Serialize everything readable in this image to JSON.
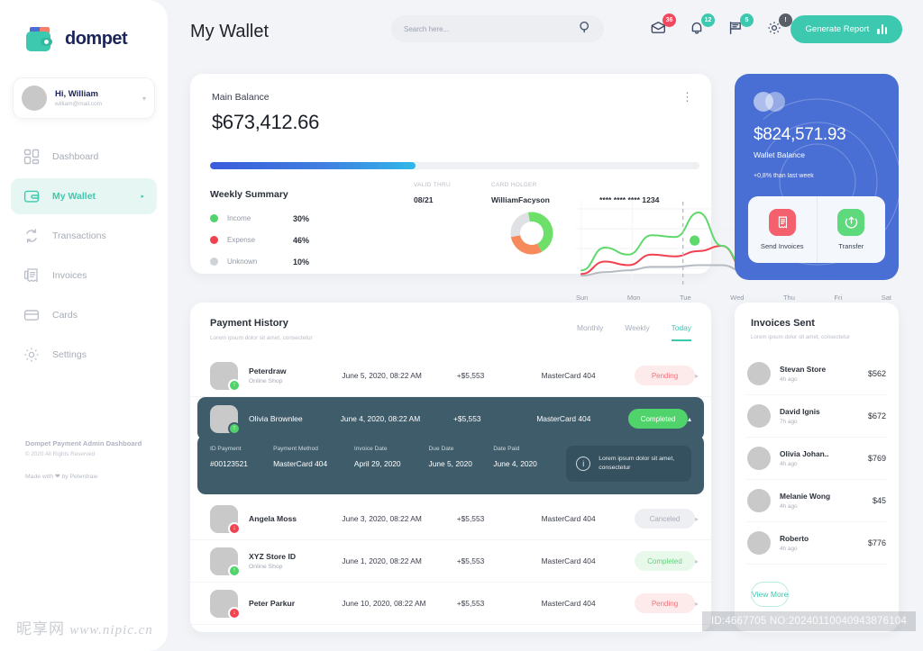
{
  "brand": {
    "name": "dompet",
    "logo_icon": "wallet-logo-icon",
    "accent": "#3dc9b0"
  },
  "sidebar": {
    "profile": {
      "greeting": "Hi, William",
      "email": "william@mail.com",
      "caret": "▾"
    },
    "items": [
      {
        "label": "Dashboard",
        "icon": "grid-icon",
        "active": false
      },
      {
        "label": "My Wallet",
        "icon": "wallet-icon",
        "active": true,
        "arrow": "▸"
      },
      {
        "label": "Transactions",
        "icon": "refresh-icon",
        "active": false
      },
      {
        "label": "Invoices",
        "icon": "receipt-icon",
        "active": false
      },
      {
        "label": "Cards",
        "icon": "card-icon",
        "active": false
      },
      {
        "label": "Settings",
        "icon": "gear-icon",
        "active": false
      }
    ],
    "footer": {
      "line1": "Dompet Payment Admin Dashboard",
      "line2": "© 2020 All Rights Reserved",
      "line3": "Made with ❤ by Peterdraw"
    }
  },
  "header": {
    "title": "My Wallet",
    "search": {
      "placeholder": "Search here...",
      "value": "",
      "icon": "search-icon"
    },
    "icons": [
      {
        "name": "mail-icon",
        "badge": "36",
        "badge_color": "red"
      },
      {
        "name": "bell-icon",
        "badge": "12",
        "badge_color": "teal"
      },
      {
        "name": "message-icon",
        "badge": "5",
        "badge_color": "teal"
      },
      {
        "name": "gear-icon",
        "badge": "!",
        "badge_color": "dark"
      }
    ],
    "generate_report": {
      "label": "Generate Report",
      "icon": "bar-chart-icon"
    }
  },
  "main_balance": {
    "label": "Main Balance",
    "amount": "$673,412.66",
    "valid_thru_label": "VALID THRU",
    "valid_thru": "08/21",
    "card_holder_label": "CARD HOLDER",
    "card_holder": "WilliamFacyson",
    "card_number": "**** **** **** 1234",
    "progress_percent": 42,
    "menu_icon": "more-vertical-icon"
  },
  "weekly_summary": {
    "title": "Weekly Summary",
    "legend": [
      {
        "label": "Income",
        "value": "30%",
        "color": "#4fd36a"
      },
      {
        "label": "Expense",
        "value": "46%",
        "color": "#f2424f"
      },
      {
        "label": "Unknown",
        "value": "10%",
        "color": "#cfd2d8"
      }
    ]
  },
  "chart_data": [
    {
      "type": "pie",
      "title": "Weekly Summary",
      "labels": [
        "Income",
        "Expense",
        "Unknown"
      ],
      "values": [
        45,
        30,
        25
      ],
      "display_values": [
        "30%",
        "46%",
        "10%"
      ],
      "colors": [
        "#6ee06a",
        "#f68a5c",
        "#dfe1e5"
      ],
      "legend": "left"
    },
    {
      "type": "line",
      "title": "",
      "x": [
        "Sun",
        "Mon",
        "Tue",
        "Wed",
        "Thu",
        "Fri",
        "Sat"
      ],
      "xlabel": "",
      "ylabel": "",
      "grid": true,
      "legend": "none",
      "marker": {
        "x": "Tue",
        "series": "Income",
        "style": "dashed-vertical-line-with-dot"
      },
      "series": [
        {
          "name": "Income",
          "color": "#5fd96c",
          "values": [
            12,
            38,
            30,
            52,
            50,
            78,
            40,
            14,
            62,
            70,
            32,
            16,
            58,
            66
          ]
        },
        {
          "name": "Expense",
          "color": "#f2424f",
          "values": [
            8,
            22,
            18,
            30,
            28,
            34,
            40,
            12,
            30,
            32,
            18,
            10,
            28,
            30
          ]
        },
        {
          "name": "Unknown",
          "color": "#b6bac2",
          "values": [
            6,
            10,
            12,
            16,
            16,
            18,
            18,
            10,
            16,
            18,
            12,
            8,
            16,
            18
          ]
        }
      ]
    }
  ],
  "wallet_card": {
    "logo_icon": "mastercard-icon",
    "amount": "$824,571.93",
    "label": "Wallet Balance",
    "delta": "+0,8% than last week",
    "actions": [
      {
        "label": "Send Invoices",
        "icon": "invoice-icon",
        "color": "#f4606b"
      },
      {
        "label": "Transfer",
        "icon": "transfer-up-icon",
        "color": "#5ed97c"
      }
    ]
  },
  "payment_history": {
    "title": "Payment History",
    "subtitle": "Lorem ipsum dolor sit amet, consectetur",
    "tabs": [
      {
        "label": "Monthly",
        "active": false
      },
      {
        "label": "Weekly",
        "active": false
      },
      {
        "label": "Today",
        "active": true
      }
    ],
    "rows": [
      {
        "name": "Peterdraw",
        "sub": "Online Shop",
        "date": "June 5, 2020, 08:22 AM",
        "amount": "+$5,553",
        "card": "MasterCard 404",
        "status": "Pending",
        "status_type": "pending",
        "badge": "up",
        "chevron": "▸",
        "expanded": false
      },
      {
        "name": "Olivia Brownlee",
        "sub": "",
        "date": "June 4, 2020, 08:22 AM",
        "amount": "+$5,553",
        "card": "MasterCard 404",
        "status": "Completed",
        "status_type": "completed-solid",
        "badge": "up",
        "chevron": "▴",
        "expanded": true
      },
      {
        "name": "Angela Moss",
        "sub": "",
        "date": "June 3, 2020, 08:22 AM",
        "amount": "+$5,553",
        "card": "MasterCard 404",
        "status": "Canceled",
        "status_type": "canceled",
        "badge": "down",
        "chevron": "▸",
        "expanded": false
      },
      {
        "name": "XYZ Store ID",
        "sub": "Online Shop",
        "date": "June 1, 2020, 08:22 AM",
        "amount": "+$5,553",
        "card": "MasterCard 404",
        "status": "Completed",
        "status_type": "completed",
        "badge": "up",
        "chevron": "▸",
        "expanded": false
      },
      {
        "name": "Peter Parkur",
        "sub": "",
        "date": "June 10, 2020, 08:22 AM",
        "amount": "+$5,553",
        "card": "MasterCard 404",
        "status": "Pending",
        "status_type": "pending",
        "badge": "down",
        "chevron": "▸",
        "expanded": false
      }
    ],
    "detail": {
      "fields": [
        {
          "key": "ID Payment",
          "value": "#00123521"
        },
        {
          "key": "Payment Method",
          "value": "MasterCard 404"
        },
        {
          "key": "Invoice Date",
          "value": "April 29, 2020"
        },
        {
          "key": "Due Date",
          "value": "June 5, 2020"
        },
        {
          "key": "Date Paid",
          "value": "June 4, 2020"
        }
      ],
      "note": "Lorem ipsum dolor sit amet, consectetur",
      "note_icon": "info-icon"
    }
  },
  "invoices_sent": {
    "title": "Invoices Sent",
    "subtitle": "Lorem ipsum dolor sit amet, consectetur",
    "rows": [
      {
        "name": "Stevan Store",
        "time": "4h ago",
        "amount": "$562"
      },
      {
        "name": "David Ignis",
        "time": "7h ago",
        "amount": "$672"
      },
      {
        "name": "Olivia Johan..",
        "time": "4h ago",
        "amount": "$769"
      },
      {
        "name": "Melanie Wong",
        "time": "4h ago",
        "amount": "$45"
      },
      {
        "name": "Roberto",
        "time": "4h ago",
        "amount": "$776"
      }
    ],
    "view_more": "View More"
  },
  "watermark": {
    "left_cn": "昵享网",
    "left_url": "www.nipic.cn",
    "right": "ID:4667705 NO:20240110040943876104"
  }
}
